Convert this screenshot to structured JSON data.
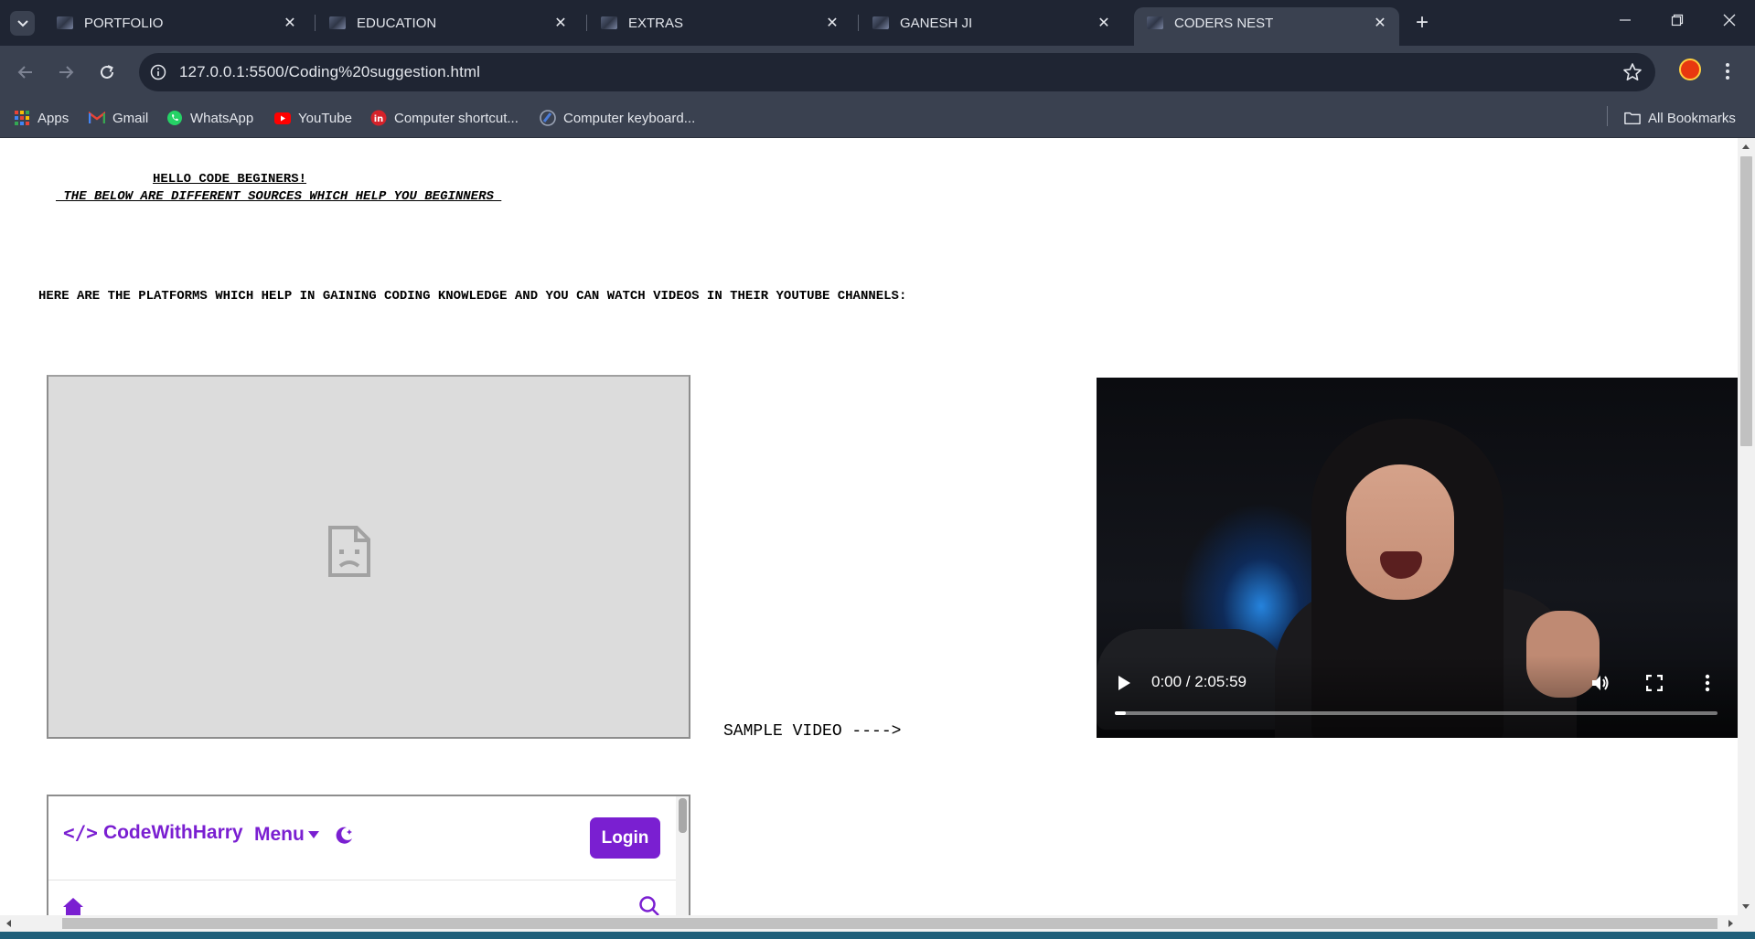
{
  "browser": {
    "tabs": [
      {
        "title": "PORTFOLIO",
        "active": false
      },
      {
        "title": "EDUCATION",
        "active": false
      },
      {
        "title": "EXTRAS",
        "active": false
      },
      {
        "title": "GANESH JI",
        "active": false
      },
      {
        "title": "CODERS NEST",
        "active": true
      }
    ],
    "url": "127.0.0.1:5500/Coding%20suggestion.html",
    "bookmarks": [
      {
        "label": "Apps",
        "icon": "apps-grid-icon"
      },
      {
        "label": "Gmail",
        "icon": "gmail-icon"
      },
      {
        "label": "WhatsApp",
        "icon": "whatsapp-icon"
      },
      {
        "label": "YouTube",
        "icon": "youtube-icon"
      },
      {
        "label": "Computer shortcut...",
        "icon": "computer-shortcut-icon"
      },
      {
        "label": "Computer keyboard...",
        "icon": "computer-keyboard-icon"
      }
    ],
    "all_bookmarks": "All Bookmarks"
  },
  "page": {
    "greeting": "HELLO CODE BEGINERS!",
    "subtitle": " THE BELOW ARE DIFFERENT SOURCES WHICH HELP YOU BEGINNERS ",
    "platforms_text": "HERE ARE THE PLATFORMS WHICH HELP IN GAINING CODING KNOWLEDGE AND YOU CAN WATCH VIDEOS IN THEIR YOUTUBE CHANNELS:",
    "sample_video_label": "SAMPLE VIDEO ---->",
    "video": {
      "time": "0:00 / 2:05:59",
      "progress_fraction": 0.0
    },
    "codewithharry": {
      "logo_glyph": "</>",
      "logo_text": "CodeWithHarry",
      "menu_label": "Menu",
      "login_label": "Login"
    }
  },
  "colors": {
    "chrome_dark": "#1f2533",
    "chrome_toolbar": "#3a4150",
    "cwh_purple": "#7a1fd1"
  }
}
